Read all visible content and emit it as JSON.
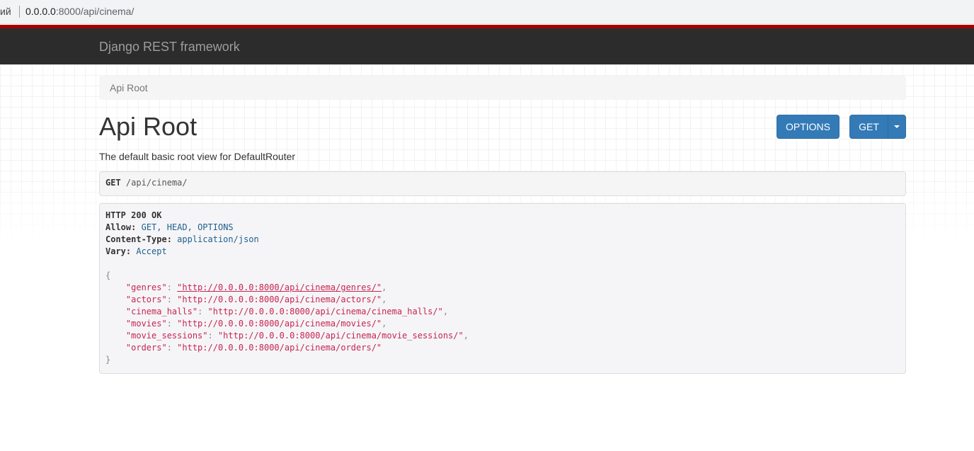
{
  "browser": {
    "tab_fragment": "ий",
    "url_host": "0.0.0.0",
    "url_rest": ":8000/api/cinema/"
  },
  "navbar": {
    "brand": "Django REST framework"
  },
  "breadcrumb": {
    "items": [
      "Api Root"
    ]
  },
  "page": {
    "title": "Api Root",
    "description": "The default basic root view for DefaultRouter"
  },
  "buttons": {
    "options": "OPTIONS",
    "get": "GET"
  },
  "request": {
    "method": "GET",
    "path": "/api/cinema/"
  },
  "response": {
    "status_line": "HTTP 200 OK",
    "headers": [
      {
        "key": "Allow:",
        "value": "GET, HEAD, OPTIONS"
      },
      {
        "key": "Content-Type:",
        "value": "application/json"
      },
      {
        "key": "Vary:",
        "value": "Accept"
      }
    ],
    "open_brace": "{",
    "close_brace": "}",
    "entries": [
      {
        "key": "\"genres\"",
        "value": "\"http://0.0.0.0:8000/api/cinema/genres/\"",
        "comma": ","
      },
      {
        "key": "\"actors\"",
        "value": "\"http://0.0.0.0:8000/api/cinema/actors/\"",
        "comma": ","
      },
      {
        "key": "\"cinema_halls\"",
        "value": "\"http://0.0.0.0:8000/api/cinema/cinema_halls/\"",
        "comma": ","
      },
      {
        "key": "\"movies\"",
        "value": "\"http://0.0.0.0:8000/api/cinema/movies/\"",
        "comma": ","
      },
      {
        "key": "\"movie_sessions\"",
        "value": "\"http://0.0.0.0:8000/api/cinema/movie_sessions/\"",
        "comma": ","
      },
      {
        "key": "\"orders\"",
        "value": "\"http://0.0.0.0:8000/api/cinema/orders/\"",
        "comma": ""
      }
    ]
  },
  "colors": {
    "navbar": "#2c2c2c",
    "accent_line": "#a30000",
    "primary_button": "#337ab7",
    "json_string": "#c7254e"
  }
}
